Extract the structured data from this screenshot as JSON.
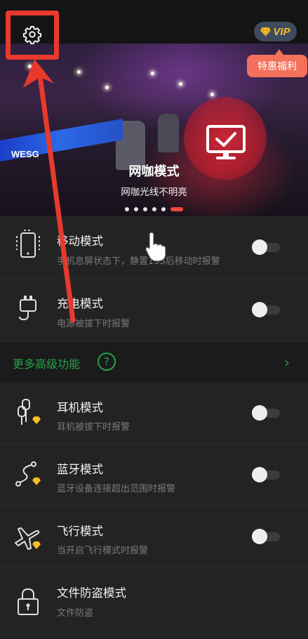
{
  "banner": {
    "mode_title": "网咖模式",
    "mode_subtitle": "网咖光线不明亮",
    "screen_text": "WESG",
    "page_indicator": {
      "count": 6,
      "active_index": 5
    }
  },
  "top_bar": {
    "settings_icon": "gear-icon",
    "vip_label": "VIP",
    "vip_icon": "diamond-icon",
    "promo_label": "特惠福利"
  },
  "colors": {
    "accent_green": "#25a046",
    "highlight_red": "#e8392d",
    "vip_gold": "#f6bf2a",
    "promo_orange": "#f3705a"
  },
  "modes_basic": [
    {
      "title": "移动模式",
      "desc": "手机息屏状态下，静置15S后移动时报警",
      "icon": "phone-motion-icon",
      "enabled": false
    },
    {
      "title": "充电模式",
      "desc": "电源被拔下时报警",
      "icon": "charger-plug-icon",
      "enabled": false
    }
  ],
  "more_features": {
    "label": "更多高级功能",
    "help_icon": "question-icon",
    "chevron_icon": "chevron-right-icon"
  },
  "modes_advanced": [
    {
      "title": "耳机模式",
      "desc": "耳机被拔下时报警",
      "icon": "earphone-icon",
      "enabled": false,
      "vip": true
    },
    {
      "title": "蓝牙模式",
      "desc": "蓝牙设备连接超出范围时报警",
      "icon": "bluetooth-route-icon",
      "enabled": false,
      "vip": true
    },
    {
      "title": "飞行模式",
      "desc": "当开启飞行模式时报警",
      "icon": "airplane-icon",
      "enabled": false,
      "vip": true
    },
    {
      "title": "文件防盗模式",
      "desc": "文件防盗",
      "icon": "lock-icon",
      "vip": false
    }
  ]
}
